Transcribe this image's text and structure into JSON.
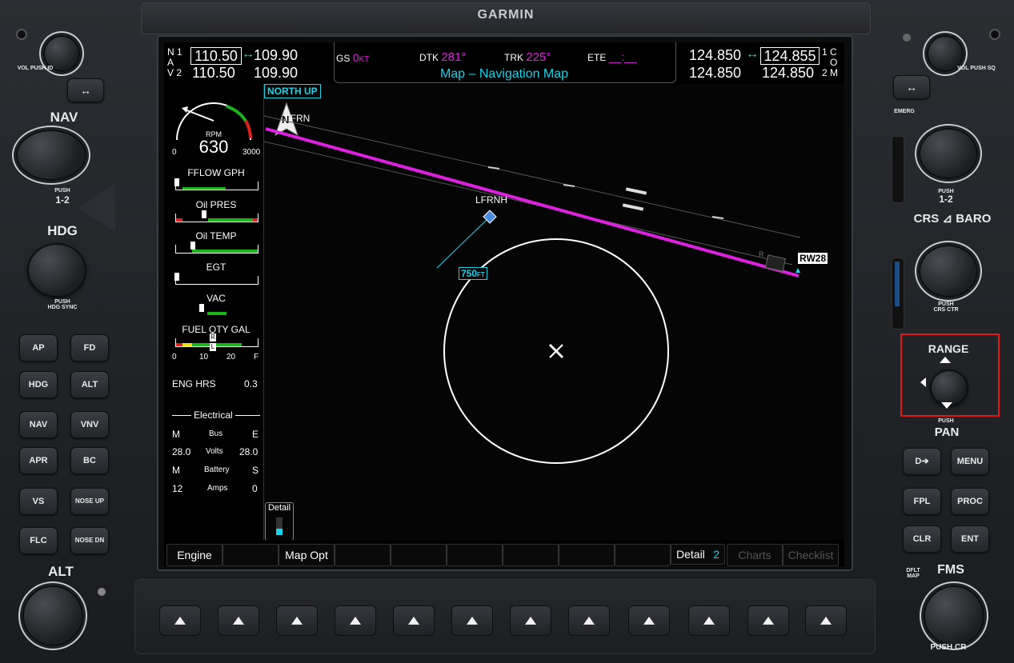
{
  "brand": "GARMIN",
  "nav": {
    "n_label": "N",
    "a_label": "A",
    "v_label": "V",
    "one": "1",
    "two": "2",
    "active1": "110.50",
    "standby1": "109.90",
    "active2": "110.50",
    "standby2": "109.90",
    "swap": "↔"
  },
  "com": {
    "c_label": "C",
    "o_label": "O",
    "m_label": "M",
    "one": "1",
    "two": "2",
    "active1": "124.850",
    "standby1": "124.855",
    "active2": "124.850",
    "standby2": "124.850",
    "swap": "↔"
  },
  "status": {
    "gs_label": "GS",
    "gs_value": "0",
    "gs_unit": "KT",
    "dtk_label": "DTK",
    "dtk_value": "281°",
    "trk_label": "TRK",
    "trk_value": "225°",
    "ete_label": "ETE",
    "ete_value": "__:__",
    "page_title": "Map – Navigation Map"
  },
  "map": {
    "orientation": "NORTH UP",
    "compass": "N",
    "waypoint_top": "LFRN",
    "airport": "LFRNH",
    "altitude": "750",
    "altitude_unit": "FT",
    "runway": "RW28",
    "runway_mark": "R",
    "detail_label": "Detail"
  },
  "eis": {
    "rpm_label": "RPM",
    "rpm_value": "630",
    "rpm_min": "0",
    "rpm_max": "3000",
    "fflow_label": "FFLOW GPH",
    "oilpres_label": "Oil PRES",
    "oiltemp_label": "Oil TEMP",
    "egt_label": "EGT",
    "vac_label": "VAC",
    "fuel_label": "FUEL QTY GAL",
    "fuel_ticks": [
      "0",
      "10",
      "20",
      "F"
    ],
    "fuel_r": "R",
    "fuel_l": "L",
    "eng_hrs_label": "ENG HRS",
    "eng_hrs_value": "0.3",
    "electrical_label": "Electrical",
    "m1": "M",
    "bus": "Bus",
    "e1": "E",
    "volts_left": "28.0",
    "volts": "Volts",
    "volts_right": "28.0",
    "m2": "M",
    "battery": "Battery",
    "s": "S",
    "amps_left": "12",
    "amps": "Amps",
    "amps_right": "0"
  },
  "softkeys": [
    "Engine",
    "",
    "Map Opt",
    "",
    "",
    "",
    "",
    "",
    "",
    "Detail",
    "Charts",
    "Checklist"
  ],
  "softkey_detail_value": "2",
  "left_panel": {
    "vol_label": "VOL",
    "vol_push": "PUSH",
    "vol_id": "ID",
    "swap": "↔",
    "nav": "NAV",
    "nav_push": "PUSH",
    "nav_12": "1-2",
    "hdg": "HDG",
    "hdg_push": "PUSH",
    "hdg_sync": "HDG SYNC",
    "alt": "ALT",
    "buttons": [
      [
        "AP",
        "FD"
      ],
      [
        "HDG",
        "ALT"
      ],
      [
        "NAV",
        "VNV"
      ],
      [
        "APR",
        "BC"
      ],
      [
        "VS",
        "NOSE UP"
      ],
      [
        "FLC",
        "NOSE DN"
      ]
    ]
  },
  "right_panel": {
    "vol_label": "VOL",
    "vol_push": "PUSH",
    "vol_sq": "SQ",
    "swap": "↔",
    "emerg": "EMERG",
    "push": "PUSH",
    "nav_12": "1-2",
    "crs": "CRS",
    "baro": "BARO",
    "crs_ctr": "CRS CTR",
    "range": "RANGE",
    "pan_push": "PUSH",
    "pan": "PAN",
    "dto": "D➔",
    "menu": "MENU",
    "fpl": "FPL",
    "proc": "PROC",
    "clr": "CLR",
    "ent": "ENT",
    "dfltmap": "DFLT MAP",
    "fms": "FMS",
    "push_cr": "PUSH CR"
  }
}
